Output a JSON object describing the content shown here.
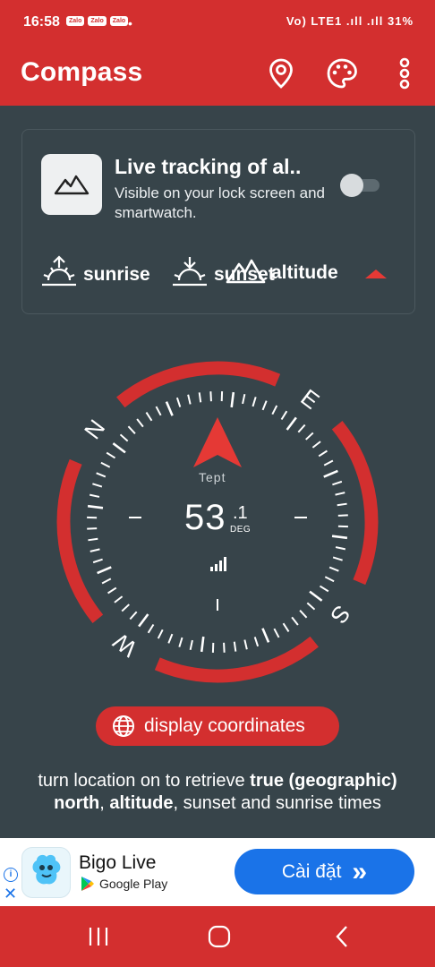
{
  "status_bar": {
    "time": "16:58",
    "apps": [
      "Zalo",
      "Zalo",
      "Zalo"
    ],
    "dot": "•",
    "right": "Vo) LTE1 .ıll .ıll 31%"
  },
  "app_bar": {
    "title": "Compass",
    "icons": [
      "location-pin-icon",
      "palette-icon",
      "more-vert-icon"
    ]
  },
  "tracking_card": {
    "title": "Live tracking of al..",
    "subtitle": "Visible on your lock screen and smartwatch.",
    "toggle_on": false,
    "items": [
      {
        "icon": "sunrise-icon",
        "label": "sunrise"
      },
      {
        "icon": "sunset-icon",
        "label": "sunset"
      },
      {
        "icon": "altitude-icon",
        "label": "altitude"
      }
    ]
  },
  "compass": {
    "heading": "53",
    "heading_decimal": ".1",
    "unit": "DEG",
    "fuzzy_label": "Tept",
    "cardinals": [
      "N",
      "E",
      "S",
      "W"
    ]
  },
  "coordinates_button": {
    "label": "display coordinates"
  },
  "hint": {
    "p1": "turn location on to retrieve ",
    "b1": "true (geographic) north",
    "p2": ", ",
    "b2": "altitude",
    "p3": ", sunset and sunrise times"
  },
  "ad": {
    "info": "i",
    "close": "✕",
    "name": "Bigo Live",
    "store": "Google Play",
    "cta": "Cài đặt",
    "cta_icon": "»"
  },
  "colors": {
    "brand_red": "#d32f2f",
    "background": "#37444a",
    "ad_blue": "#1a73e8"
  }
}
